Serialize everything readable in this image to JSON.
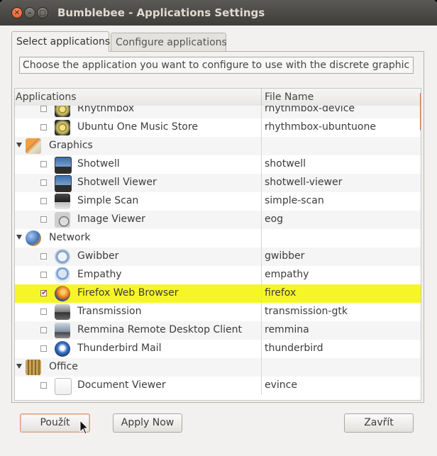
{
  "window": {
    "title": "Bumblebee - Applications Settings",
    "close_glyph": "✕",
    "minimize_glyph": "–",
    "maximize_glyph": "□"
  },
  "tabs": [
    {
      "label": "Select applications",
      "active": true
    },
    {
      "label": "Configure applications",
      "active": false
    }
  ],
  "description": "Choose the application you want to configure to use with the discrete graphic card.",
  "table": {
    "columns": [
      "Applications",
      "File Name"
    ],
    "rows": [
      {
        "type": "app",
        "name": "Rhythmbox",
        "file": "rhythmbox-device",
        "checked": false,
        "icon": "rhythmbox-icon"
      },
      {
        "type": "app",
        "name": "Ubuntu One Music Store",
        "file": "rhythmbox-ubuntuone",
        "checked": false,
        "icon": "rhythmbox-icon"
      },
      {
        "type": "category",
        "name": "Graphics",
        "icon": "graphics-category-icon"
      },
      {
        "type": "app",
        "name": "Shotwell",
        "file": "shotwell",
        "checked": false,
        "icon": "shotwell-icon"
      },
      {
        "type": "app",
        "name": "Shotwell Viewer",
        "file": "shotwell-viewer",
        "checked": false,
        "icon": "shotwell-icon"
      },
      {
        "type": "app",
        "name": "Simple Scan",
        "file": "simple-scan",
        "checked": false,
        "icon": "scanner-icon"
      },
      {
        "type": "app",
        "name": "Image Viewer",
        "file": "eog",
        "checked": false,
        "icon": "image-viewer-icon"
      },
      {
        "type": "category",
        "name": "Network",
        "icon": "network-globe-icon"
      },
      {
        "type": "app",
        "name": "Gwibber",
        "file": "gwibber",
        "checked": false,
        "icon": "gwibber-icon"
      },
      {
        "type": "app",
        "name": "Empathy",
        "file": "empathy",
        "checked": false,
        "icon": "empathy-icon"
      },
      {
        "type": "app",
        "name": "Firefox Web Browser",
        "file": "firefox",
        "checked": true,
        "selected": true,
        "icon": "firefox-icon"
      },
      {
        "type": "app",
        "name": "Transmission",
        "file": "transmission-gtk",
        "checked": false,
        "icon": "transmission-icon"
      },
      {
        "type": "app",
        "name": "Remmina Remote Desktop Client",
        "file": "remmina",
        "checked": false,
        "icon": "remmina-icon"
      },
      {
        "type": "app",
        "name": "Thunderbird Mail",
        "file": "thunderbird",
        "checked": false,
        "icon": "thunderbird-icon"
      },
      {
        "type": "category",
        "name": "Office",
        "icon": "office-category-icon"
      },
      {
        "type": "app",
        "name": "Document Viewer",
        "file": "evince",
        "checked": false,
        "icon": "document-viewer-icon"
      }
    ]
  },
  "buttons": {
    "apply": "Použít",
    "apply_now": "Apply Now",
    "close": "Zavřít"
  },
  "colors": {
    "selection": "#f6f626",
    "accent": "#e2683c"
  }
}
